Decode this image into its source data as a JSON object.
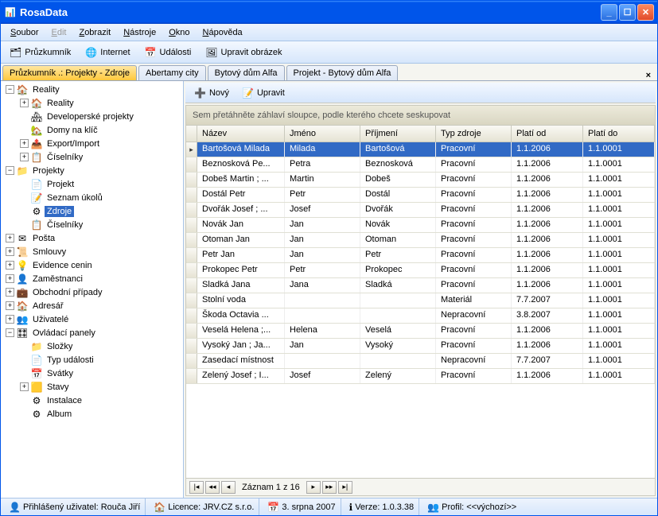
{
  "title": "RosaData",
  "menu": [
    "Soubor",
    "Edit",
    "Zobrazit",
    "Nástroje",
    "Okno",
    "Nápověda"
  ],
  "toolbar": [
    {
      "label": "Průzkumník",
      "icon": "🗂"
    },
    {
      "label": "Internet",
      "icon": "🌐"
    },
    {
      "label": "Události",
      "icon": "📅"
    },
    {
      "label": "Upravit obrázek",
      "icon": "🖼"
    }
  ],
  "tabs": [
    "Průzkumník .: Projekty - Zdroje",
    "Abertamy city",
    "Bytový dům Alfa",
    "Projekt - Bytový dům Alfa"
  ],
  "tree": [
    {
      "d": 0,
      "e": "-",
      "i": "🏠",
      "t": "Reality"
    },
    {
      "d": 1,
      "e": "+",
      "i": "🏠",
      "t": "Reality"
    },
    {
      "d": 1,
      "e": "",
      "i": "🏘",
      "t": "Developerské projekty"
    },
    {
      "d": 1,
      "e": "",
      "i": "🏡",
      "t": "Domy na klíč"
    },
    {
      "d": 1,
      "e": "+",
      "i": "📤",
      "t": "Export/Import"
    },
    {
      "d": 1,
      "e": "+",
      "i": "📋",
      "t": "Číselníky"
    },
    {
      "d": 0,
      "e": "-",
      "i": "📁",
      "t": "Projekty"
    },
    {
      "d": 1,
      "e": "",
      "i": "📄",
      "t": "Projekt"
    },
    {
      "d": 1,
      "e": "",
      "i": "📝",
      "t": "Seznam úkolů"
    },
    {
      "d": 1,
      "e": "",
      "i": "⚙",
      "t": "Zdroje",
      "sel": true
    },
    {
      "d": 1,
      "e": "",
      "i": "📋",
      "t": "Číselníky"
    },
    {
      "d": 0,
      "e": "+",
      "i": "✉",
      "t": "Pošta"
    },
    {
      "d": 0,
      "e": "+",
      "i": "📜",
      "t": "Smlouvy"
    },
    {
      "d": 0,
      "e": "+",
      "i": "💡",
      "t": "Evidence cenin"
    },
    {
      "d": 0,
      "e": "+",
      "i": "👤",
      "t": "Zaměstnanci"
    },
    {
      "d": 0,
      "e": "+",
      "i": "💼",
      "t": "Obchodní případy"
    },
    {
      "d": 0,
      "e": "+",
      "i": "🏠",
      "t": "Adresář"
    },
    {
      "d": 0,
      "e": "+",
      "i": "👥",
      "t": "Uživatelé"
    },
    {
      "d": 0,
      "e": "-",
      "i": "🎛",
      "t": "Ovládací panely"
    },
    {
      "d": 1,
      "e": "",
      "i": "📁",
      "t": "Složky"
    },
    {
      "d": 1,
      "e": "",
      "i": "📄",
      "t": "Typ události"
    },
    {
      "d": 1,
      "e": "",
      "i": "📅",
      "t": "Svátky"
    },
    {
      "d": 1,
      "e": "+",
      "i": "🟨",
      "t": "Stavy"
    },
    {
      "d": 1,
      "e": "",
      "i": "⚙",
      "t": "Instalace"
    },
    {
      "d": 1,
      "e": "",
      "i": "⚙",
      "t": "Album"
    }
  ],
  "inner_toolbar": {
    "new": "Nový",
    "edit": "Upravit"
  },
  "group_hint": "Sem přetáhněte záhlaví sloupce, podle kterého chcete seskupovat",
  "columns": [
    "Název",
    "Jméno",
    "Příjmení",
    "Typ zdroje",
    "Platí od",
    "Platí do"
  ],
  "rows": [
    {
      "c": [
        "Bartošová Milada",
        "Milada",
        "Bartošová",
        "Pracovní",
        "1.1.2006",
        "1.1.0001"
      ],
      "sel": true
    },
    {
      "c": [
        "Beznosková Pe...",
        "Petra",
        "Beznosková",
        "Pracovní",
        "1.1.2006",
        "1.1.0001"
      ]
    },
    {
      "c": [
        "Dobeš Martin ; ...",
        "Martin",
        "Dobeš",
        "Pracovní",
        "1.1.2006",
        "1.1.0001"
      ]
    },
    {
      "c": [
        "Dostál Petr",
        "Petr",
        "Dostál",
        "Pracovní",
        "1.1.2006",
        "1.1.0001"
      ]
    },
    {
      "c": [
        "Dvořák Josef ; ...",
        "Josef",
        "Dvořák",
        "Pracovní",
        "1.1.2006",
        "1.1.0001"
      ]
    },
    {
      "c": [
        "Novák Jan",
        "Jan",
        "Novák",
        "Pracovní",
        "1.1.2006",
        "1.1.0001"
      ]
    },
    {
      "c": [
        "Otoman Jan",
        "Jan",
        "Otoman",
        "Pracovní",
        "1.1.2006",
        "1.1.0001"
      ]
    },
    {
      "c": [
        "Petr Jan",
        "Jan",
        "Petr",
        "Pracovní",
        "1.1.2006",
        "1.1.0001"
      ]
    },
    {
      "c": [
        "Prokopec Petr",
        "Petr",
        "Prokopec",
        "Pracovní",
        "1.1.2006",
        "1.1.0001"
      ]
    },
    {
      "c": [
        "Sladká Jana",
        "Jana",
        "Sladká",
        "Pracovní",
        "1.1.2006",
        "1.1.0001"
      ]
    },
    {
      "c": [
        "Stolní voda",
        "",
        "",
        "Materiál",
        "7.7.2007",
        "1.1.0001"
      ]
    },
    {
      "c": [
        "Škoda Octavia ...",
        "",
        "",
        "Nepracovní",
        "3.8.2007",
        "1.1.0001"
      ]
    },
    {
      "c": [
        "Veselá Helena ;...",
        "Helena",
        "Veselá",
        "Pracovní",
        "1.1.2006",
        "1.1.0001"
      ]
    },
    {
      "c": [
        "Vysoký Jan ; Ja...",
        "Jan",
        "Vysoký",
        "Pracovní",
        "1.1.2006",
        "1.1.0001"
      ]
    },
    {
      "c": [
        "Zasedací místnost",
        "",
        "",
        "Nepracovní",
        "7.7.2007",
        "1.1.0001"
      ]
    },
    {
      "c": [
        "Zelený Josef ; I...",
        "Josef",
        "Zelený",
        "Pracovní",
        "1.1.2006",
        "1.1.0001"
      ]
    }
  ],
  "pager": "Záznam 1 z 16",
  "status": {
    "user_label": "Přihlášený uživatel:",
    "user": "Rouča Jiří",
    "licence_label": "Licence:",
    "licence": "JRV.CZ s.r.o.",
    "date": "3. srpna 2007",
    "version_label": "Verze:",
    "version": "1.0.3.38",
    "profile_label": "Profil:",
    "profile": "<<výchozí>>"
  }
}
